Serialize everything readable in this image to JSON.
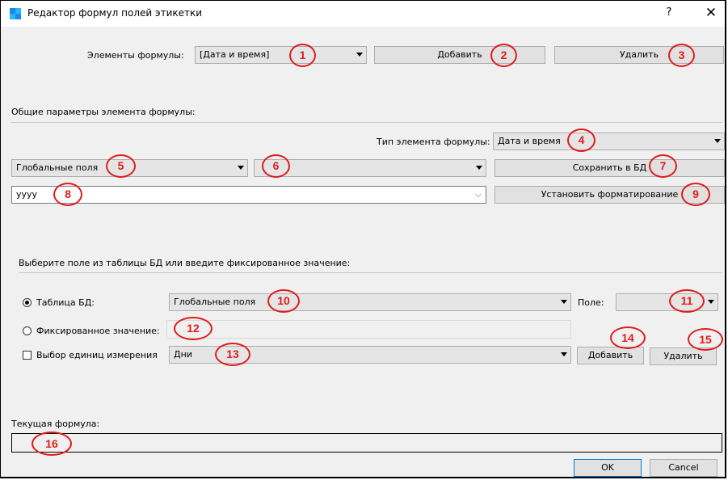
{
  "window": {
    "title": "Редактор формул полей этикетки",
    "help_label": "?",
    "close_label": "✕"
  },
  "formula_elements": {
    "label": "Элементы формулы:",
    "selected": "[Дата и время]",
    "add_label": "Добавить",
    "delete_label": "Удалить"
  },
  "general_params": {
    "heading": "Общие параметры элемента формулы:",
    "type_label": "Тип элемента формулы:",
    "type_selected": "Дата и время",
    "source_selected": "Глобальные поля",
    "field_selected": "",
    "save_db_label": "Сохранить в БД",
    "format_value": "yyyy",
    "set_format_label": "Установить форматирование"
  },
  "select_field": {
    "heading": "Выберите поле из таблицы БД или введите фиксированное значение:",
    "db_table_label": "Таблица БД:",
    "db_table_selected": "Глобальные поля",
    "field_label": "Поле:",
    "field_selected": "",
    "fixed_value_label": "Фиксированное значение:",
    "fixed_value": "",
    "units_label": "Выбор единиц измерения",
    "units_selected": "Дни",
    "add_label": "Добавить",
    "delete_label": "Удалить"
  },
  "current_formula": {
    "label": "Текущая формула:",
    "value": ""
  },
  "footer": {
    "ok_label": "OK",
    "cancel_label": "Cancel"
  },
  "markers": [
    "1",
    "2",
    "3",
    "4",
    "5",
    "6",
    "7",
    "8",
    "9",
    "10",
    "11",
    "12",
    "13",
    "14",
    "15",
    "16"
  ],
  "colors": {
    "marker": "#e01c1c",
    "dialog_bg": "#f0f0f0",
    "icon_blue": "#1e88e5",
    "icon_cyan": "#29b6f6"
  }
}
